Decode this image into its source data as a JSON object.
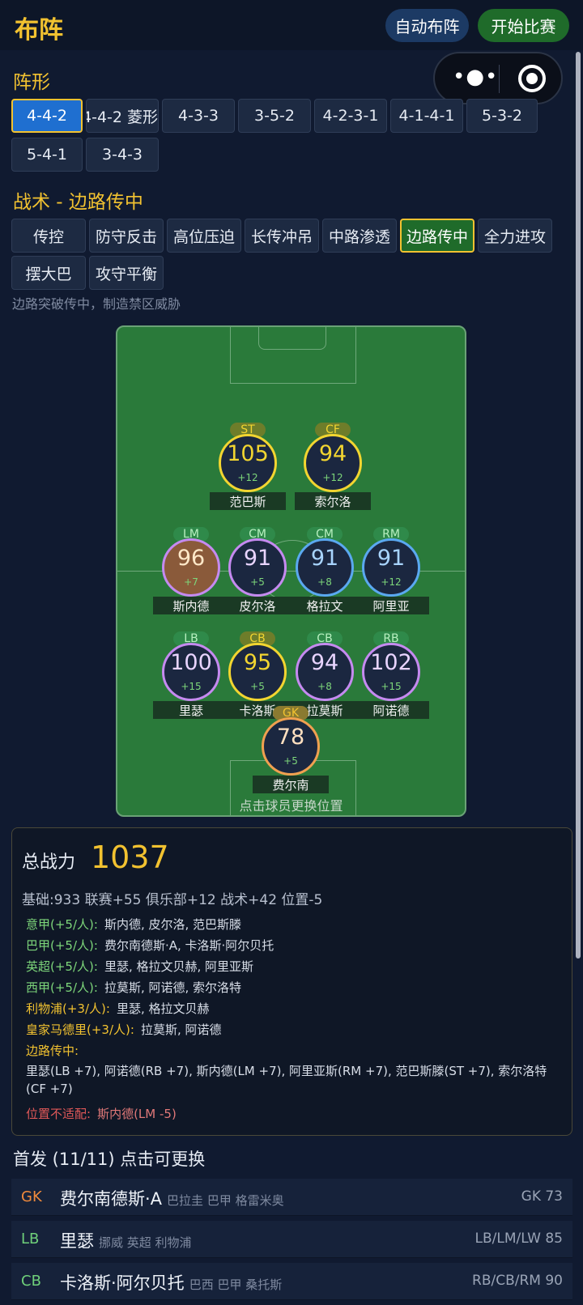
{
  "header": {
    "title": "布阵",
    "auto_label": "自动布阵",
    "start_label": "开始比赛",
    "capsule_more_icon": "more-dots-icon",
    "capsule_close_icon": "target-close-icon"
  },
  "formation": {
    "title": "阵形",
    "options": [
      "4-4-2",
      "4-4-2 菱形",
      "4-3-3",
      "3-5-2",
      "4-2-3-1",
      "4-1-4-1",
      "5-3-2",
      "5-4-1",
      "3-4-3"
    ],
    "selected": "4-4-2"
  },
  "tactics": {
    "title": "战术 - 边路传中",
    "options": [
      "传控",
      "防守反击",
      "高位压迫",
      "长传冲吊",
      "中路渗透",
      "边路传中",
      "全力进攻",
      "摆大巴",
      "攻守平衡"
    ],
    "selected": "边路传中",
    "description": "边路突破传中，制造禁区威胁"
  },
  "pitch": {
    "hint": "点击球员更换位置",
    "players": [
      {
        "pos": "ST",
        "rating": "105",
        "bonus": "+12",
        "name": "范巴斯",
        "tier": "gold"
      },
      {
        "pos": "CF",
        "rating": "94",
        "bonus": "+12",
        "name": "索尔洛",
        "tier": "gold"
      },
      {
        "pos": "LM",
        "rating": "96",
        "bonus": "+7",
        "name": "斯内德",
        "tier": "purple-brown"
      },
      {
        "pos": "CM",
        "rating": "91",
        "bonus": "+5",
        "name": "皮尔洛",
        "tier": "purple"
      },
      {
        "pos": "CM",
        "rating": "91",
        "bonus": "+8",
        "name": "格拉文",
        "tier": "blue"
      },
      {
        "pos": "RM",
        "rating": "91",
        "bonus": "+12",
        "name": "阿里亚",
        "tier": "blue"
      },
      {
        "pos": "LB",
        "rating": "100",
        "bonus": "+15",
        "name": "里瑟",
        "tier": "purple"
      },
      {
        "pos": "CB",
        "rating": "95",
        "bonus": "+5",
        "name": "卡洛斯",
        "tier": "gold"
      },
      {
        "pos": "CB",
        "rating": "94",
        "bonus": "+8",
        "name": "拉莫斯",
        "tier": "purple"
      },
      {
        "pos": "RB",
        "rating": "102",
        "bonus": "+15",
        "name": "阿诺德",
        "tier": "purple"
      },
      {
        "pos": "GK",
        "rating": "78",
        "bonus": "+5",
        "name": "费尔南",
        "tier": "orange"
      }
    ]
  },
  "summary": {
    "label": "总战力",
    "value": "1037",
    "breakdown": "基础:933  联赛+55  俱乐部+12  战术+42  位置-5",
    "lines": [
      {
        "tag": "意甲(+5/人):",
        "who": "斯内德, 皮尔洛, 范巴斯滕",
        "color": "#7dd67a"
      },
      {
        "tag": "巴甲(+5/人):",
        "who": "费尔南德斯·A, 卡洛斯·阿尔贝托",
        "color": "#7dd67a"
      },
      {
        "tag": "英超(+5/人):",
        "who": "里瑟, 格拉文贝赫, 阿里亚斯",
        "color": "#7dd67a"
      },
      {
        "tag": "西甲(+5/人):",
        "who": "拉莫斯, 阿诺德, 索尔洛特",
        "color": "#7dd67a"
      },
      {
        "tag": "利物浦(+3/人):",
        "who": "里瑟, 格拉文贝赫",
        "color": "#f2c230"
      },
      {
        "tag": "皇家马德里(+3/人):",
        "who": "拉莫斯, 阿诺德",
        "color": "#f2c230"
      }
    ],
    "tactic_tag": "边路传中:",
    "tactic_detail": "里瑟(LB +7), 阿诺德(RB +7), 斯内德(LM +7), 阿里亚斯(RM +7), 范巴斯滕(ST +7), 索尔洛特(CF +7)",
    "penalty_tag": "位置不适配:",
    "penalty_detail": "斯内德(LM -5)"
  },
  "starters": {
    "title": "首发 (11/11)  点击可更换",
    "rows": [
      {
        "pos": "GK",
        "name": "费尔南德斯·A",
        "tags": "巴拉圭 巴甲 格雷米奥",
        "stat": "GK 73",
        "color": "#f08a3c"
      },
      {
        "pos": "LB",
        "name": "里瑟",
        "tags": "挪威 英超 利物浦",
        "stat": "LB/LM/LW 85",
        "color": "#6fd07a"
      },
      {
        "pos": "CB",
        "name": "卡洛斯·阿尔贝托",
        "tags": "巴西 巴甲 桑托斯",
        "stat": "RB/CB/RM 90",
        "color": "#6fd07a"
      }
    ]
  }
}
